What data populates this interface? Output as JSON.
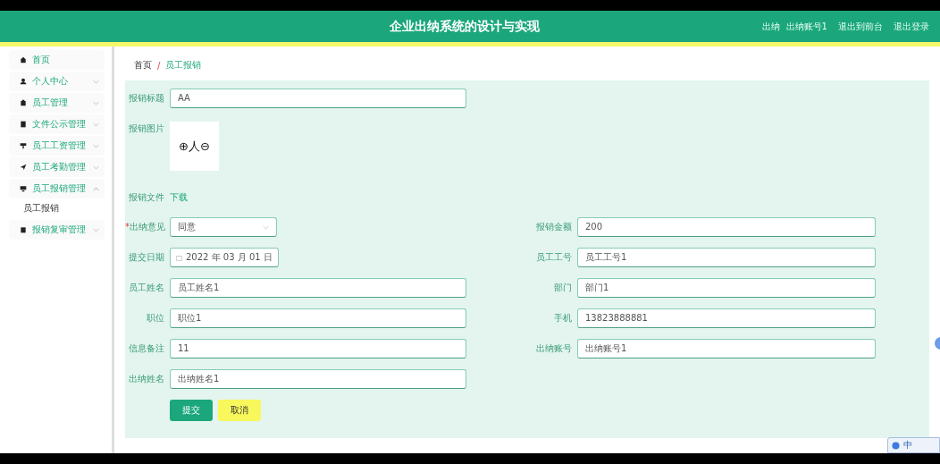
{
  "header": {
    "title": "企业出纳系统的设计与实现",
    "user": "出纳  出纳账号1",
    "links": [
      "退出到前台",
      "退出登录"
    ]
  },
  "sidebar": {
    "items": [
      {
        "label": "首页"
      },
      {
        "label": "个人中心",
        "expanded": false
      },
      {
        "label": "员工管理",
        "expanded": false
      },
      {
        "label": "文件公示管理",
        "expanded": false
      },
      {
        "label": "员工工资管理",
        "expanded": false
      },
      {
        "label": "员工考勤管理",
        "expanded": false
      },
      {
        "label": "员工报销管理",
        "expanded": true,
        "children": [
          {
            "label": "员工报销"
          }
        ]
      },
      {
        "label": "报销复审管理",
        "expanded": false
      }
    ]
  },
  "breadcrumb": {
    "items": [
      "首页",
      "员工报销"
    ],
    "separator": "/"
  },
  "form": {
    "rows": [
      [
        {
          "kind": "text",
          "label": "报销标题",
          "value": "AA"
        }
      ],
      [
        {
          "kind": "image",
          "label": "报销图片",
          "value": "⊕人⊖"
        }
      ],
      [
        {
          "kind": "file",
          "label": "报销文件",
          "value": "下载"
        }
      ],
      [
        {
          "kind": "select",
          "label": "出纳意见",
          "value": "同意",
          "required_mark": "*"
        },
        {
          "kind": "text",
          "label": "报销金额",
          "value": "200"
        }
      ],
      [
        {
          "kind": "date",
          "label": "提交日期",
          "value": "2022 年 03 月 01 日"
        },
        {
          "kind": "text",
          "label": "员工工号",
          "value": "员工工号1"
        }
      ],
      [
        {
          "kind": "text",
          "label": "员工姓名",
          "value": "员工姓名1"
        },
        {
          "kind": "text",
          "label": "部门",
          "value": "部门1"
        }
      ],
      [
        {
          "kind": "text",
          "label": "职位",
          "value": "职位1"
        },
        {
          "kind": "text",
          "label": "手机",
          "value": "13823888881"
        }
      ],
      [
        {
          "kind": "text",
          "label": "信息备注",
          "value": "11"
        },
        {
          "kind": "text",
          "label": "出纳账号",
          "value": "出纳账号1"
        }
      ],
      [
        {
          "kind": "text",
          "label": "出纳姓名",
          "value": "出纳姓名1"
        }
      ]
    ],
    "buttons": [
      {
        "kind": "submit",
        "label": "提交"
      },
      {
        "kind": "cancel",
        "label": "取消"
      }
    ]
  },
  "ime_toolbar": {
    "label": "中"
  }
}
